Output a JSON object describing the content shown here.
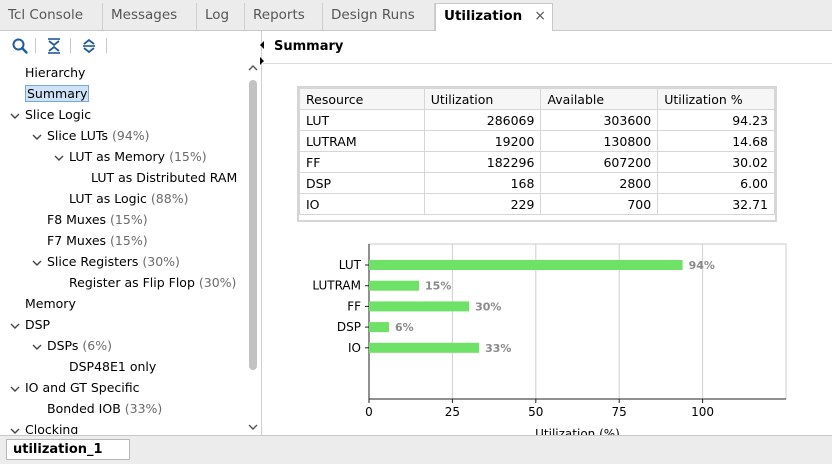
{
  "tabs": [
    {
      "label": "Tcl Console",
      "active": false
    },
    {
      "label": "Messages",
      "active": false
    },
    {
      "label": "Log",
      "active": false
    },
    {
      "label": "Reports",
      "active": false
    },
    {
      "label": "Design Runs",
      "active": false
    },
    {
      "label": "Utilization",
      "active": true
    }
  ],
  "tab_close_glyph": "×",
  "toolbar": {
    "icons": [
      "search-icon",
      "collapse-all-icon",
      "expand-all-icon"
    ]
  },
  "tree": [
    {
      "label": "Hierarchy",
      "pct": "",
      "level": 0,
      "expander": "none",
      "selected": false
    },
    {
      "label": "Summary",
      "pct": "",
      "level": 0,
      "expander": "none",
      "selected": true
    },
    {
      "label": "Slice Logic",
      "pct": "",
      "level": 0,
      "expander": "expanded",
      "selected": false
    },
    {
      "label": "Slice LUTs",
      "pct": "(94%)",
      "level": 1,
      "expander": "expanded",
      "selected": false
    },
    {
      "label": "LUT as Memory",
      "pct": "(15%)",
      "level": 2,
      "expander": "expanded",
      "selected": false
    },
    {
      "label": "LUT as Distributed RAM",
      "pct": "",
      "level": 3,
      "expander": "none",
      "selected": false
    },
    {
      "label": "LUT as Logic",
      "pct": "(88%)",
      "level": 2,
      "expander": "none",
      "selected": false
    },
    {
      "label": "F8 Muxes",
      "pct": "(15%)",
      "level": 1,
      "expander": "none",
      "selected": false
    },
    {
      "label": "F7 Muxes",
      "pct": "(15%)",
      "level": 1,
      "expander": "none",
      "selected": false
    },
    {
      "label": "Slice Registers",
      "pct": "(30%)",
      "level": 1,
      "expander": "expanded",
      "selected": false
    },
    {
      "label": "Register as Flip Flop",
      "pct": "(30%)",
      "level": 2,
      "expander": "none",
      "selected": false
    },
    {
      "label": "Memory",
      "pct": "",
      "level": 0,
      "expander": "none",
      "selected": false
    },
    {
      "label": "DSP",
      "pct": "",
      "level": 0,
      "expander": "expanded",
      "selected": false
    },
    {
      "label": "DSPs",
      "pct": "(6%)",
      "level": 1,
      "expander": "expanded",
      "selected": false
    },
    {
      "label": "DSP48E1 only",
      "pct": "",
      "level": 2,
      "expander": "none",
      "selected": false
    },
    {
      "label": "IO and GT Specific",
      "pct": "",
      "level": 0,
      "expander": "expanded",
      "selected": false
    },
    {
      "label": "Bonded IOB",
      "pct": "(33%)",
      "level": 1,
      "expander": "none",
      "selected": false
    },
    {
      "label": "Clocking",
      "pct": "",
      "level": 0,
      "expander": "expanded",
      "selected": false
    }
  ],
  "summary_title": "Summary",
  "table": {
    "headers": [
      "Resource",
      "Utilization",
      "Available",
      "Utilization %"
    ],
    "rows": [
      [
        "LUT",
        "286069",
        "303600",
        "94.23"
      ],
      [
        "LUTRAM",
        "19200",
        "130800",
        "14.68"
      ],
      [
        "FF",
        "182296",
        "607200",
        "30.02"
      ],
      [
        "DSP",
        "168",
        "2800",
        "6.00"
      ],
      [
        "IO",
        "229",
        "700",
        "32.71"
      ]
    ]
  },
  "chart_data": {
    "type": "bar",
    "orientation": "horizontal",
    "categories": [
      "LUT",
      "LUTRAM",
      "FF",
      "DSP",
      "IO"
    ],
    "values": [
      94,
      15,
      30,
      6,
      33
    ],
    "value_labels": [
      "94%",
      "15%",
      "30%",
      "6%",
      "33%"
    ],
    "xlabel": "Utilization (%)",
    "ylabel": "",
    "xlim": [
      0,
      125
    ],
    "xticks": [
      0,
      25,
      50,
      75,
      100
    ],
    "grid": true,
    "bar_color": "#6ee266",
    "label_color": "#8a8a8a"
  },
  "bottom_tab": "utilization_1",
  "colors": {
    "selection_bg": "#cfe3f8",
    "selection_border": "#7aa7d6",
    "panel_bg": "#ececec",
    "icon_blue": "#1f5c99"
  }
}
